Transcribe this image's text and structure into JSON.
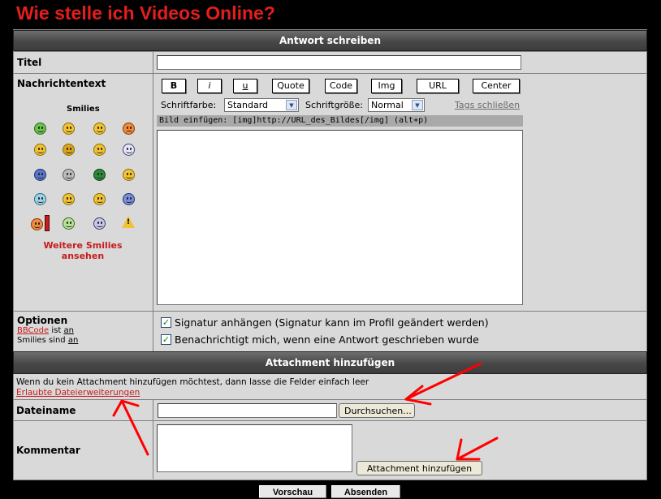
{
  "page": {
    "title": "Wie stelle ich Videos Online?"
  },
  "reply": {
    "header": "Antwort schreiben",
    "title_label": "Titel",
    "message_label": "Nachrichtentext",
    "smilies_heading": "Smilies",
    "more_smilies": "Weitere Smilies ansehen",
    "bbcode_buttons": [
      "B",
      "i",
      "u",
      "Quote",
      "Code",
      "Img",
      "URL",
      "Center"
    ],
    "font_color_label": "Schriftfarbe:",
    "font_color_value": "Standard",
    "font_size_label": "Schriftgröße:",
    "font_size_value": "Normal",
    "close_tags": "Tags schließen",
    "helpline": "Bild einfügen: [img]http://URL_des_Bildes[/img] (alt+p)"
  },
  "options": {
    "label": "Optionen",
    "bbcode_link": "BBCode",
    "bbcode_is": "ist",
    "bbcode_state": "an",
    "smilies_text": "Smilies sind",
    "smilies_state": "an",
    "signature": "Signatur anhängen (Signatur kann im Profil geändert werden)",
    "notify": "Benachrichtigt mich, wenn eine Antwort geschrieben wurde"
  },
  "attachment": {
    "header": "Attachment hinzufügen",
    "hint": "Wenn du kein Attachment hinzufügen möchtest, dann lasse die Felder einfach leer",
    "allowed_extensions": "Erlaubte Dateierweiterungen",
    "filename_label": "Dateiname",
    "browse_button": "Durchsuchen...",
    "comment_label": "Kommentar",
    "add_button": "Attachment hinzufügen"
  },
  "footer": {
    "preview_button": "Vorschau",
    "submit_button": "Absenden"
  },
  "colors": {
    "title_red": "#e31e1e",
    "link_red": "#c81c1c",
    "annotation_red": "#ff0000",
    "panel_gray": "#d9d9d9"
  }
}
